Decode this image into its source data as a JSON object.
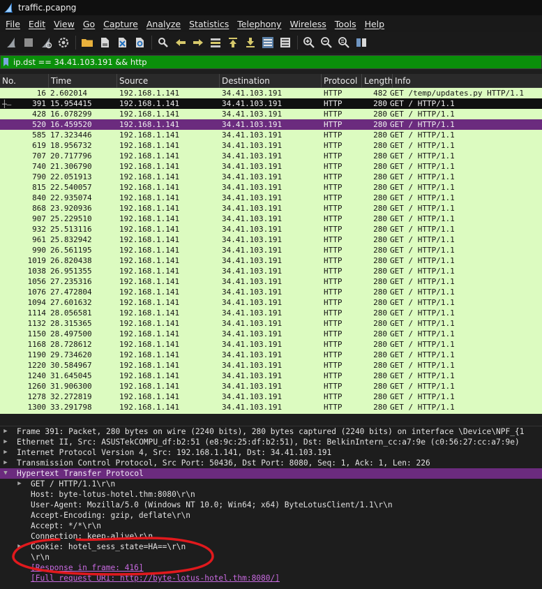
{
  "window": {
    "title": "traffic.pcapng"
  },
  "menu": [
    "File",
    "Edit",
    "View",
    "Go",
    "Capture",
    "Analyze",
    "Statistics",
    "Telephony",
    "Wireless",
    "Tools",
    "Help"
  ],
  "toolbar": {
    "icons": [
      "shark-fin-start-icon",
      "stop-icon",
      "restart-icon",
      "capture-options-icon",
      "open-folder-icon",
      "save-file-icon",
      "close-file-icon",
      "reload-icon",
      "search-icon",
      "go-back-icon",
      "go-forward-icon",
      "go-to-packet-icon",
      "go-first-icon",
      "go-last-icon",
      "autoscroll-icon",
      "colorize-icon",
      "zoom-in-icon",
      "zoom-out-icon",
      "zoom-normal-icon",
      "resize-columns-icon"
    ]
  },
  "filter": {
    "value": "ip.dst == 34.41.103.191 && http"
  },
  "columns": [
    "No.",
    "Time",
    "Source",
    "Destination",
    "Protocol",
    "Length",
    "Info"
  ],
  "packets": [
    [
      "16",
      "2.602014",
      "192.168.1.141",
      "34.41.103.191",
      "HTTP",
      "482",
      "GET /temp/updates.py HTTP/1.1"
    ],
    [
      "391",
      "15.954415",
      "192.168.1.141",
      "34.41.103.191",
      "HTTP",
      "280",
      "GET / HTTP/1.1"
    ],
    [
      "428",
      "16.078299",
      "192.168.1.141",
      "34.41.103.191",
      "HTTP",
      "280",
      "GET / HTTP/1.1"
    ],
    [
      "520",
      "16.459520",
      "192.168.1.141",
      "34.41.103.191",
      "HTTP",
      "280",
      "GET / HTTP/1.1"
    ],
    [
      "585",
      "17.323446",
      "192.168.1.141",
      "34.41.103.191",
      "HTTP",
      "280",
      "GET / HTTP/1.1"
    ],
    [
      "619",
      "18.956732",
      "192.168.1.141",
      "34.41.103.191",
      "HTTP",
      "280",
      "GET / HTTP/1.1"
    ],
    [
      "707",
      "20.717796",
      "192.168.1.141",
      "34.41.103.191",
      "HTTP",
      "280",
      "GET / HTTP/1.1"
    ],
    [
      "740",
      "21.306790",
      "192.168.1.141",
      "34.41.103.191",
      "HTTP",
      "280",
      "GET / HTTP/1.1"
    ],
    [
      "790",
      "22.051913",
      "192.168.1.141",
      "34.41.103.191",
      "HTTP",
      "280",
      "GET / HTTP/1.1"
    ],
    [
      "815",
      "22.540057",
      "192.168.1.141",
      "34.41.103.191",
      "HTTP",
      "280",
      "GET / HTTP/1.1"
    ],
    [
      "840",
      "22.935074",
      "192.168.1.141",
      "34.41.103.191",
      "HTTP",
      "280",
      "GET / HTTP/1.1"
    ],
    [
      "868",
      "23.920936",
      "192.168.1.141",
      "34.41.103.191",
      "HTTP",
      "280",
      "GET / HTTP/1.1"
    ],
    [
      "907",
      "25.229510",
      "192.168.1.141",
      "34.41.103.191",
      "HTTP",
      "280",
      "GET / HTTP/1.1"
    ],
    [
      "932",
      "25.513116",
      "192.168.1.141",
      "34.41.103.191",
      "HTTP",
      "280",
      "GET / HTTP/1.1"
    ],
    [
      "961",
      "25.832942",
      "192.168.1.141",
      "34.41.103.191",
      "HTTP",
      "280",
      "GET / HTTP/1.1"
    ],
    [
      "990",
      "26.561195",
      "192.168.1.141",
      "34.41.103.191",
      "HTTP",
      "280",
      "GET / HTTP/1.1"
    ],
    [
      "1019",
      "26.820438",
      "192.168.1.141",
      "34.41.103.191",
      "HTTP",
      "280",
      "GET / HTTP/1.1"
    ],
    [
      "1038",
      "26.951355",
      "192.168.1.141",
      "34.41.103.191",
      "HTTP",
      "280",
      "GET / HTTP/1.1"
    ],
    [
      "1056",
      "27.235316",
      "192.168.1.141",
      "34.41.103.191",
      "HTTP",
      "280",
      "GET / HTTP/1.1"
    ],
    [
      "1076",
      "27.472804",
      "192.168.1.141",
      "34.41.103.191",
      "HTTP",
      "280",
      "GET / HTTP/1.1"
    ],
    [
      "1094",
      "27.601632",
      "192.168.1.141",
      "34.41.103.191",
      "HTTP",
      "280",
      "GET / HTTP/1.1"
    ],
    [
      "1114",
      "28.056581",
      "192.168.1.141",
      "34.41.103.191",
      "HTTP",
      "280",
      "GET / HTTP/1.1"
    ],
    [
      "1132",
      "28.315365",
      "192.168.1.141",
      "34.41.103.191",
      "HTTP",
      "280",
      "GET / HTTP/1.1"
    ],
    [
      "1150",
      "28.497500",
      "192.168.1.141",
      "34.41.103.191",
      "HTTP",
      "280",
      "GET / HTTP/1.1"
    ],
    [
      "1168",
      "28.728612",
      "192.168.1.141",
      "34.41.103.191",
      "HTTP",
      "280",
      "GET / HTTP/1.1"
    ],
    [
      "1190",
      "29.734620",
      "192.168.1.141",
      "34.41.103.191",
      "HTTP",
      "280",
      "GET / HTTP/1.1"
    ],
    [
      "1220",
      "30.584967",
      "192.168.1.141",
      "34.41.103.191",
      "HTTP",
      "280",
      "GET / HTTP/1.1"
    ],
    [
      "1240",
      "31.645045",
      "192.168.1.141",
      "34.41.103.191",
      "HTTP",
      "280",
      "GET / HTTP/1.1"
    ],
    [
      "1260",
      "31.906300",
      "192.168.1.141",
      "34.41.103.191",
      "HTTP",
      "280",
      "GET / HTTP/1.1"
    ],
    [
      "1278",
      "32.272819",
      "192.168.1.141",
      "34.41.103.191",
      "HTTP",
      "280",
      "GET / HTTP/1.1"
    ],
    [
      "1300",
      "33.291798",
      "192.168.1.141",
      "34.41.103.191",
      "HTTP",
      "280",
      "GET / HTTP/1.1"
    ]
  ],
  "packet_marks": {
    "391": "selected",
    "520": "highlight"
  },
  "colors": {
    "row_bg": "#dcfbc0",
    "selected_bg": "#101010",
    "highlight_bg": "#6b2b7e",
    "filter_bg": "#0a8f0a",
    "link": "#c86ae0",
    "annotation": "#e0191d"
  },
  "details": [
    {
      "text": "Frame 391: Packet, 280 bytes on wire (2240 bits), 280 bytes captured (2240 bits) on interface \\Device\\NPF_{1",
      "indent": 0,
      "expander": "collapsed"
    },
    {
      "text": "Ethernet II, Src: ASUSTekCOMPU_df:b2:51 (e8:9c:25:df:b2:51), Dst: BelkinIntern_cc:a7:9e (c0:56:27:cc:a7:9e)",
      "indent": 0,
      "expander": "collapsed"
    },
    {
      "text": "Internet Protocol Version 4, Src: 192.168.1.141, Dst: 34.41.103.191",
      "indent": 0,
      "expander": "collapsed"
    },
    {
      "text": "Transmission Control Protocol, Src Port: 50436, Dst Port: 8080, Seq: 1, Ack: 1, Len: 226",
      "indent": 0,
      "expander": "collapsed"
    },
    {
      "text": "Hypertext Transfer Protocol",
      "indent": 0,
      "expander": "expanded",
      "highlight": true
    },
    {
      "text": "GET / HTTP/1.1\\r\\n",
      "indent": 1,
      "expander": "collapsed"
    },
    {
      "text": "Host: byte-lotus-hotel.thm:8080\\r\\n",
      "indent": 1,
      "expander": "none"
    },
    {
      "text": "User-Agent: Mozilla/5.0 (Windows NT 10.0; Win64; x64) ByteLotusClient/1.1\\r\\n",
      "indent": 1,
      "expander": "none"
    },
    {
      "text": "Accept-Encoding: gzip, deflate\\r\\n",
      "indent": 1,
      "expander": "none"
    },
    {
      "text": "Accept: */*\\r\\n",
      "indent": 1,
      "expander": "none"
    },
    {
      "text": "Connection: keep-alive\\r\\n",
      "indent": 1,
      "expander": "none"
    },
    {
      "text": "Cookie: hotel_sess_state=HA==\\r\\n",
      "indent": 1,
      "expander": "collapsed"
    },
    {
      "text": "\\r\\n",
      "indent": 1,
      "expander": "none"
    },
    {
      "text": "[Response in frame: 416]",
      "indent": 1,
      "expander": "none",
      "link": true
    },
    {
      "text": "[Full request URI: http://byte-lotus-hotel.thm:8080/]",
      "indent": 1,
      "expander": "none",
      "link": true
    }
  ]
}
